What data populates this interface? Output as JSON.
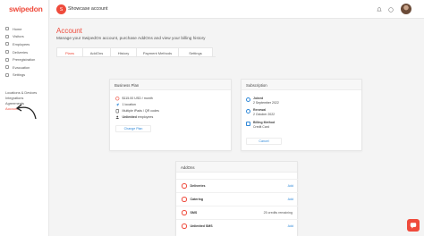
{
  "brand": {
    "logo": "swipedon",
    "accent": "#ef4b3c",
    "link": "#2f88d8"
  },
  "sidebar": {
    "items": [
      {
        "label": "Home",
        "icon": "home-icon"
      },
      {
        "label": "Visitors",
        "icon": "visitors-icon"
      },
      {
        "label": "Employees",
        "icon": "employees-icon"
      },
      {
        "label": "Deliveries",
        "icon": "deliveries-icon"
      },
      {
        "label": "Preregistration",
        "icon": "preregistration-icon"
      },
      {
        "label": "Evacuation",
        "icon": "evacuation-icon"
      },
      {
        "label": "Settings",
        "icon": "settings-icon"
      }
    ],
    "section": [
      "Locations & Devices",
      "Integrations",
      "Agreements",
      "Account"
    ]
  },
  "topbar": {
    "account_initial": "S",
    "account_name": "Showcase account"
  },
  "page": {
    "title": "Account",
    "subtitle": "Manage your SwipedOn account, purchase AddOns and view your billing history",
    "tabs": [
      "Plans",
      "AddOns",
      "History",
      "Payment Methods",
      "Settings"
    ]
  },
  "business_plan": {
    "header": "Business Plan",
    "price": "$115.00 USD / month",
    "locations": "1 location",
    "ipads": "Multiple iPads / QR codes",
    "employees_bold": "Unlimited",
    "employees_rest": "employees",
    "button": "Change Plan"
  },
  "subscription": {
    "header": "Subscription",
    "joined_label": "Joined",
    "joined_value": "2 September 2022",
    "renewal_label": "Renewal",
    "renewal_value": "2 October 2022",
    "billing_label": "Billing Method",
    "billing_value": "Credit Card",
    "button": "Cancel"
  },
  "addons": {
    "header": "AddOns",
    "rows": [
      {
        "name": "Deliveries",
        "action": "Add",
        "credits": ""
      },
      {
        "name": "Catering",
        "action": "Add",
        "credits": ""
      },
      {
        "name": "SMS",
        "action": "",
        "credits": "25 credits remaining"
      },
      {
        "name": "Unlimited SMS",
        "action": "Add",
        "credits": ""
      }
    ]
  }
}
